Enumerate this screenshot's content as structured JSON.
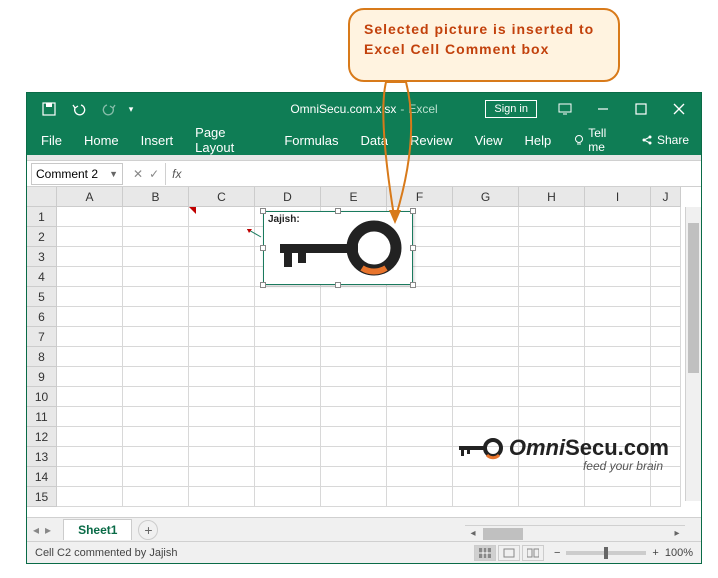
{
  "callout": {
    "text": "Selected picture is inserted to Excel Cell Comment box"
  },
  "titlebar": {
    "filename": "OmniSecu.com.xlsx",
    "separator": "-",
    "app": "Excel",
    "signin": "Sign in"
  },
  "ribbon": {
    "tabs": [
      "File",
      "Home",
      "Insert",
      "Page Layout",
      "Formulas",
      "Data",
      "Review",
      "View",
      "Help"
    ],
    "tellme": "Tell me",
    "share": "Share"
  },
  "formula_bar": {
    "namebox": "Comment 2",
    "fx_label": "fx"
  },
  "grid": {
    "columns": [
      "A",
      "B",
      "C",
      "D",
      "E",
      "F",
      "G",
      "H",
      "I",
      "J"
    ],
    "rows": [
      "1",
      "2",
      "3",
      "4",
      "5",
      "6",
      "7",
      "8",
      "9",
      "10",
      "11",
      "12",
      "13",
      "14",
      "15"
    ]
  },
  "comment": {
    "author": "Jajish:"
  },
  "watermark": {
    "brand_prefix": "Omni",
    "brand_suffix": "Secu.com",
    "tagline": "feed your brain"
  },
  "sheets": {
    "active": "Sheet1",
    "add_label": "+"
  },
  "status": {
    "text": "Cell C2 commented by Jajish",
    "zoom": "100%"
  }
}
